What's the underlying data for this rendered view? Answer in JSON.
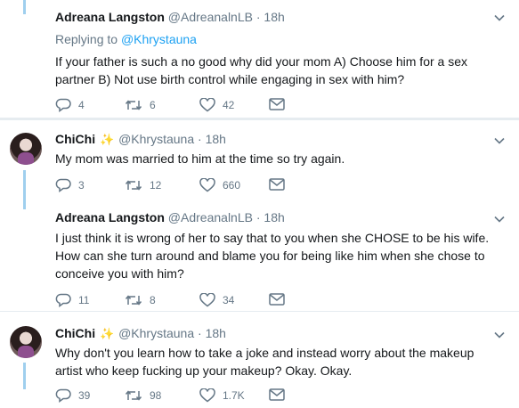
{
  "tweets": [
    {
      "name": "Adreana Langston",
      "handle": "@AdreanalnLB",
      "dot": "·",
      "time": "18h",
      "replying_label": "Replying to",
      "replying_to": "@Khrystauna",
      "text_line1": "If your father is such a no good why did your mom A) Choose him for a sex",
      "text_line2": "partner B) Not use birth control while engaging in sex with him?",
      "replies": "4",
      "retweets": "6",
      "likes": "42"
    },
    {
      "name": "ChiChi",
      "sparkle": "✨",
      "handle": "@Khrystauna",
      "dot": "·",
      "time": "18h",
      "text_line1": "My mom was married to him at the time so try again.",
      "replies": "3",
      "retweets": "12",
      "likes": "660"
    },
    {
      "name": "Adreana Langston",
      "handle": "@AdreanalnLB",
      "dot": "·",
      "time": "18h",
      "text_line1": "I just think it is wrong of her to say that to you when she CHOSE to be his wife.",
      "text_line2": "How can she turn around and blame you for being like him when she chose to",
      "text_line3": "conceive you with him?",
      "replies": "11",
      "retweets": "8",
      "likes": "34"
    },
    {
      "name": "ChiChi",
      "sparkle": "✨",
      "handle": "@Khrystauna",
      "dot": "·",
      "time": "18h",
      "text_line1": "Why don't you learn how to take a joke and instead worry about the makeup",
      "text_line2": "artist who keep fucking up your makeup? Okay. Okay.",
      "replies": "39",
      "retweets": "98",
      "likes": "1.7K"
    }
  ],
  "icons": {
    "reply": "reply-icon",
    "retweet": "retweet-icon",
    "like": "heart-icon",
    "dm": "envelope-icon",
    "menu": "chevron-down-icon"
  },
  "colors": {
    "text": "#14171a",
    "muted": "#657786",
    "link": "#1da1f2",
    "thread": "#9fcfee",
    "separator": "#e6ecf0"
  }
}
